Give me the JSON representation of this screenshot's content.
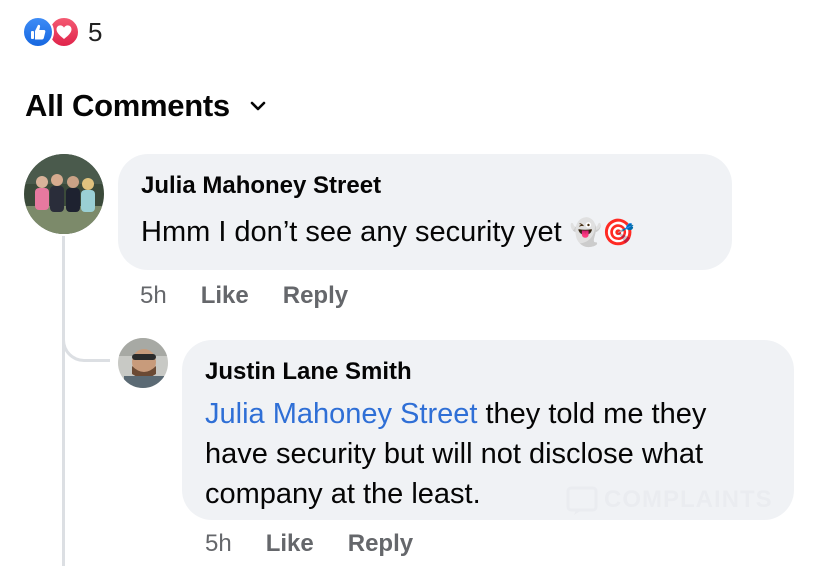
{
  "reactions": {
    "count": "5",
    "types": [
      "like-icon",
      "love-icon"
    ]
  },
  "comments_header": {
    "label": "All Comments"
  },
  "comments": [
    {
      "author": "Julia Mahoney Street",
      "text": "Hmm I don’t see any security yet",
      "emojis": "👻🎯",
      "time": "5h",
      "like": "Like",
      "reply": "Reply"
    },
    {
      "author": "Justin Lane Smith",
      "mention": "Julia Mahoney Street",
      "text": " they told me they have security but will not disclose what company at the least.",
      "time": "5h",
      "like": "Like",
      "reply": "Reply"
    }
  ],
  "watermark": {
    "text": "COMPLAINTS"
  },
  "colors": {
    "like_blue": "#1877f2",
    "love_red": "#e4284f",
    "mention_blue": "#2f6fd6",
    "bubble_bg": "#f0f2f5",
    "meta_gray": "#65676b"
  }
}
